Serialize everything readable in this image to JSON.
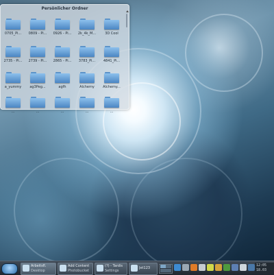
{
  "folderview": {
    "title": "Persönlicher Ordner",
    "items": [
      {
        "label": "0705_Pi..."
      },
      {
        "label": "0809 - Pi..."
      },
      {
        "label": "0926 - Pi..."
      },
      {
        "label": "2k_4k_M..."
      },
      {
        "label": "3D Cool"
      },
      {
        "label": "2735 - Pi..."
      },
      {
        "label": "2739 - Pi..."
      },
      {
        "label": "2865 - Pi..."
      },
      {
        "label": "3783_Pi..."
      },
      {
        "label": "4841_Pi..."
      },
      {
        "label": "a_yummy"
      },
      {
        "label": "ag3Peg..."
      },
      {
        "label": "agfh"
      },
      {
        "label": "Alchemy"
      },
      {
        "label": "Alchemy..."
      },
      {
        "label": "..."
      },
      {
        "label": "..."
      },
      {
        "label": "..."
      },
      {
        "label": "..."
      },
      {
        "label": "..."
      }
    ]
  },
  "taskbar": {
    "tasks": [
      {
        "line1": "Arbeitsfl.",
        "line2": "Desktop"
      },
      {
        "line1": "Add Content",
        "line2": "Photobucket"
      },
      {
        "line1": "(?) - Tardis",
        "line2": "Settings"
      },
      {
        "line1": "Jet123",
        "line2": ""
      }
    ],
    "clock": {
      "line1": "12:05",
      "line2": "18.03"
    }
  }
}
